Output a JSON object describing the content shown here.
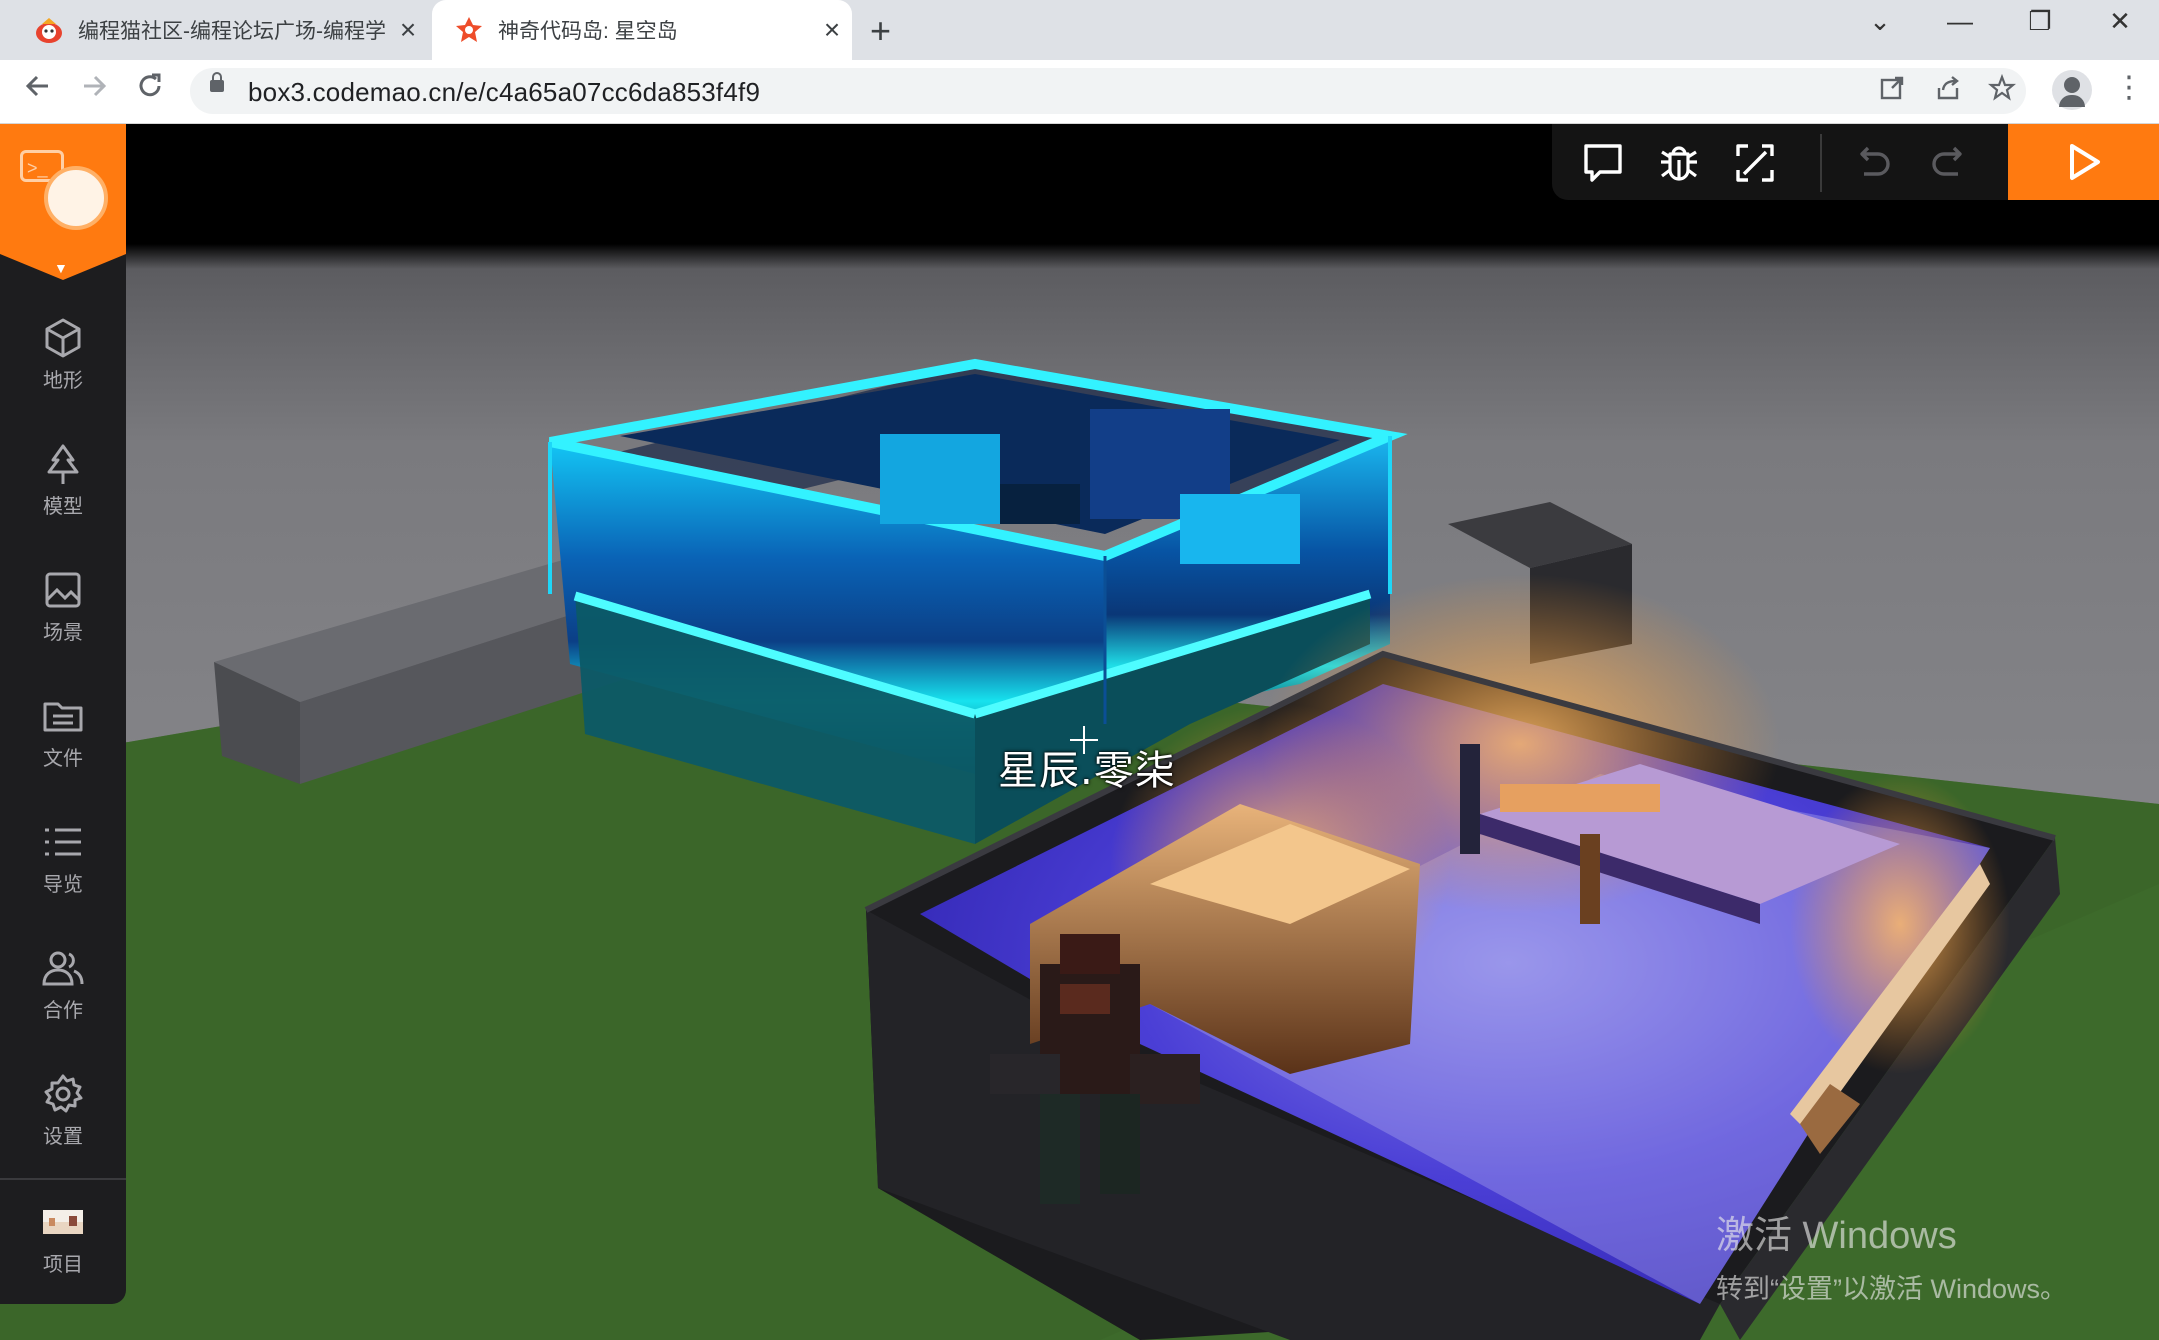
{
  "browser": {
    "tabs": [
      {
        "title": "编程猫社区-编程论坛广场-编程学",
        "close": "×",
        "active": false,
        "icon": "codemao-favicon-icon"
      },
      {
        "title": "神奇代码岛: 星空岛",
        "close": "×",
        "active": true,
        "icon": "box3-favicon-icon"
      }
    ],
    "new_tab": "+",
    "window_controls": {
      "dropdown": "⌄",
      "minimize": "—",
      "restore": "❐",
      "close": "✕"
    },
    "url": "box3.codemao.cn/e/c4a65a07cc6da853f4f9"
  },
  "sidebar": {
    "items": [
      {
        "label": "地形",
        "icon": "cube-icon"
      },
      {
        "label": "模型",
        "icon": "tree-icon"
      },
      {
        "label": "场景",
        "icon": "image-icon"
      },
      {
        "label": "文件",
        "icon": "folder-icon"
      },
      {
        "label": "导览",
        "icon": "list-icon"
      },
      {
        "label": "合作",
        "icon": "users-icon"
      },
      {
        "label": "设置",
        "icon": "gear-icon"
      },
      {
        "label": "项目",
        "icon": "project-thumbnail-icon"
      }
    ]
  },
  "toolbar": {
    "buttons": [
      "comment-icon",
      "debug-bug-icon",
      "fullscreen-icon",
      "undo-icon",
      "redo-icon",
      "play-icon"
    ]
  },
  "scene": {
    "player_name": "星辰.零柒"
  },
  "watermark": {
    "line1": "激活 Windows",
    "line2": "转到“设置”以激活 Windows。"
  },
  "colors": {
    "accent": "#ff7a10",
    "neon": "#21d4ff",
    "grass": "#3e6a2c",
    "water": "#3a2fd0"
  }
}
